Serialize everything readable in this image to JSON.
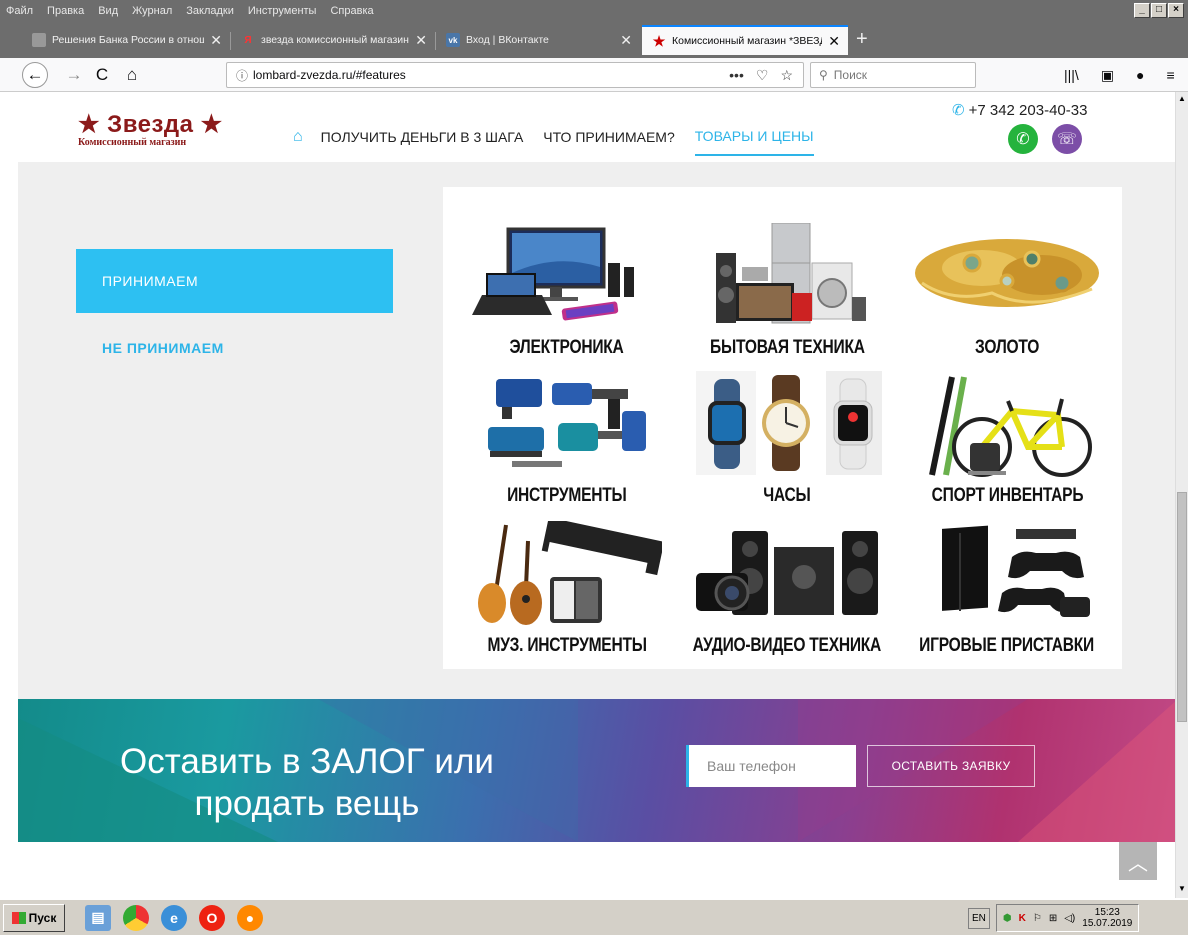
{
  "menubar": {
    "items": [
      "Файл",
      "Правка",
      "Вид",
      "Журнал",
      "Закладки",
      "Инструменты",
      "Справка"
    ]
  },
  "tabs": [
    {
      "title": "Решения Банка России в отноше",
      "favicon": "cbr-icon"
    },
    {
      "title": "звезда комиссионный магазин п",
      "favicon": "yandex-icon"
    },
    {
      "title": "Вход | ВКонтакте",
      "favicon": "vk-icon"
    },
    {
      "title": "Комиссионный магазин *ЗВЕЗДА",
      "favicon": "star-icon",
      "active": true
    }
  ],
  "navbar": {
    "url": "lombard-zvezda.ru/#features",
    "search_placeholder": "Поиск"
  },
  "site": {
    "logo_name": "★ Звезда ★",
    "logo_sub": "Комиссионный магазин",
    "nav": [
      "ПОЛУЧИТЬ ДЕНЬГИ В 3 ШАГА",
      "ЧТО ПРИНИМАЕМ?",
      "ТОВАРЫ И ЦЕНЫ"
    ],
    "active_nav_index": 2,
    "phone": "+7 342 203-40-33",
    "accent": "#2db4e8",
    "brand": "#8b1a1a"
  },
  "sidetabs": {
    "accept": "ПРИНИМАЕМ",
    "decline": "НЕ ПРИНИМАЕМ"
  },
  "categories": [
    "ЭЛЕКТРОНИКА",
    "БЫТОВАЯ ТЕХНИКА",
    "ЗОЛОТО",
    "ИНСТРУМЕНТЫ",
    "ЧАСЫ",
    "СПОРТ ИНВЕНТАРЬ",
    "МУЗ. ИНСТРУМЕНТЫ",
    "АУДИО-ВИДЕО ТЕХНИКА",
    "ИГРОВЫЕ ПРИСТАВКИ"
  ],
  "banner": {
    "line1": "Оставить в ЗАЛОГ или",
    "line2": "продать вещь",
    "phone_placeholder": "Ваш телефон",
    "submit": "ОСТАВИТЬ ЗАЯВКУ"
  },
  "taskbar": {
    "start": "Пуск",
    "lang": "EN",
    "time": "15:23",
    "date": "15.07.2019"
  }
}
